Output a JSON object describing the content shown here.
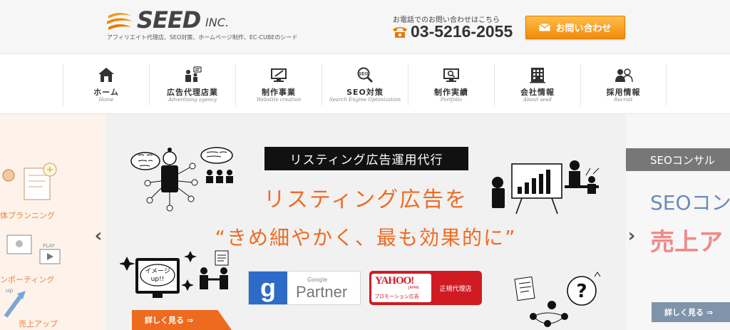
{
  "header": {
    "logo_text": "SEED",
    "logo_suffix": "INC.",
    "tagline": "アフィリエイト代理店、SEO対策、ホームページ制作、EC-CUBEのシード",
    "tel_caption": "お電話でのお問い合わせはこちら",
    "tel_number": "03-5216-2055",
    "contact_label": "お問い合わせ",
    "accent_color": "#f08a0a"
  },
  "nav": {
    "items": [
      {
        "jp": "ホーム",
        "en": "Home",
        "icon": "house-icon"
      },
      {
        "jp": "広告代理店業",
        "en": "Advertising agency",
        "icon": "people-chat-icon"
      },
      {
        "jp": "制作事業",
        "en": "Webstite creation",
        "icon": "monitor-pen-icon"
      },
      {
        "jp": "SEO対策",
        "en": "Search Engine Optimization",
        "icon": "magnifier-seo-icon"
      },
      {
        "jp": "制作実績",
        "en": "Portfolio",
        "icon": "monitor-search-icon"
      },
      {
        "jp": "会社情報",
        "en": "About seed",
        "icon": "building-icon"
      },
      {
        "jp": "採用情報",
        "en": "Recruit",
        "icon": "users-icon"
      }
    ]
  },
  "slider": {
    "left": {
      "labels": [
        "体プランニング",
        "ンポーティング",
        "売上アップ"
      ],
      "play_label": "PLAY",
      "up_label": "up"
    },
    "main": {
      "badge": "リスティング広告運用代行",
      "title": "リスティング広告を",
      "subtitle": "“きめ細やかく、最も効果的に”",
      "bubble_text": "イメージ\nup!!",
      "google_small": "Google",
      "google_partner": "Partner",
      "yahoo_logo": "YAHOO!",
      "yahoo_japan": "JAPAN",
      "yahoo_promo": "プロモーション広告",
      "yahoo_agency": "正規代理店",
      "detail_label": "詳しく見る ⇒"
    },
    "right": {
      "badge": "SEOコンサル",
      "title": "SEOコン",
      "subtitle": "売上ア",
      "detail_label": "詳しく見る ⇒"
    },
    "prev_arrow": "‹",
    "next_arrow": "›"
  }
}
